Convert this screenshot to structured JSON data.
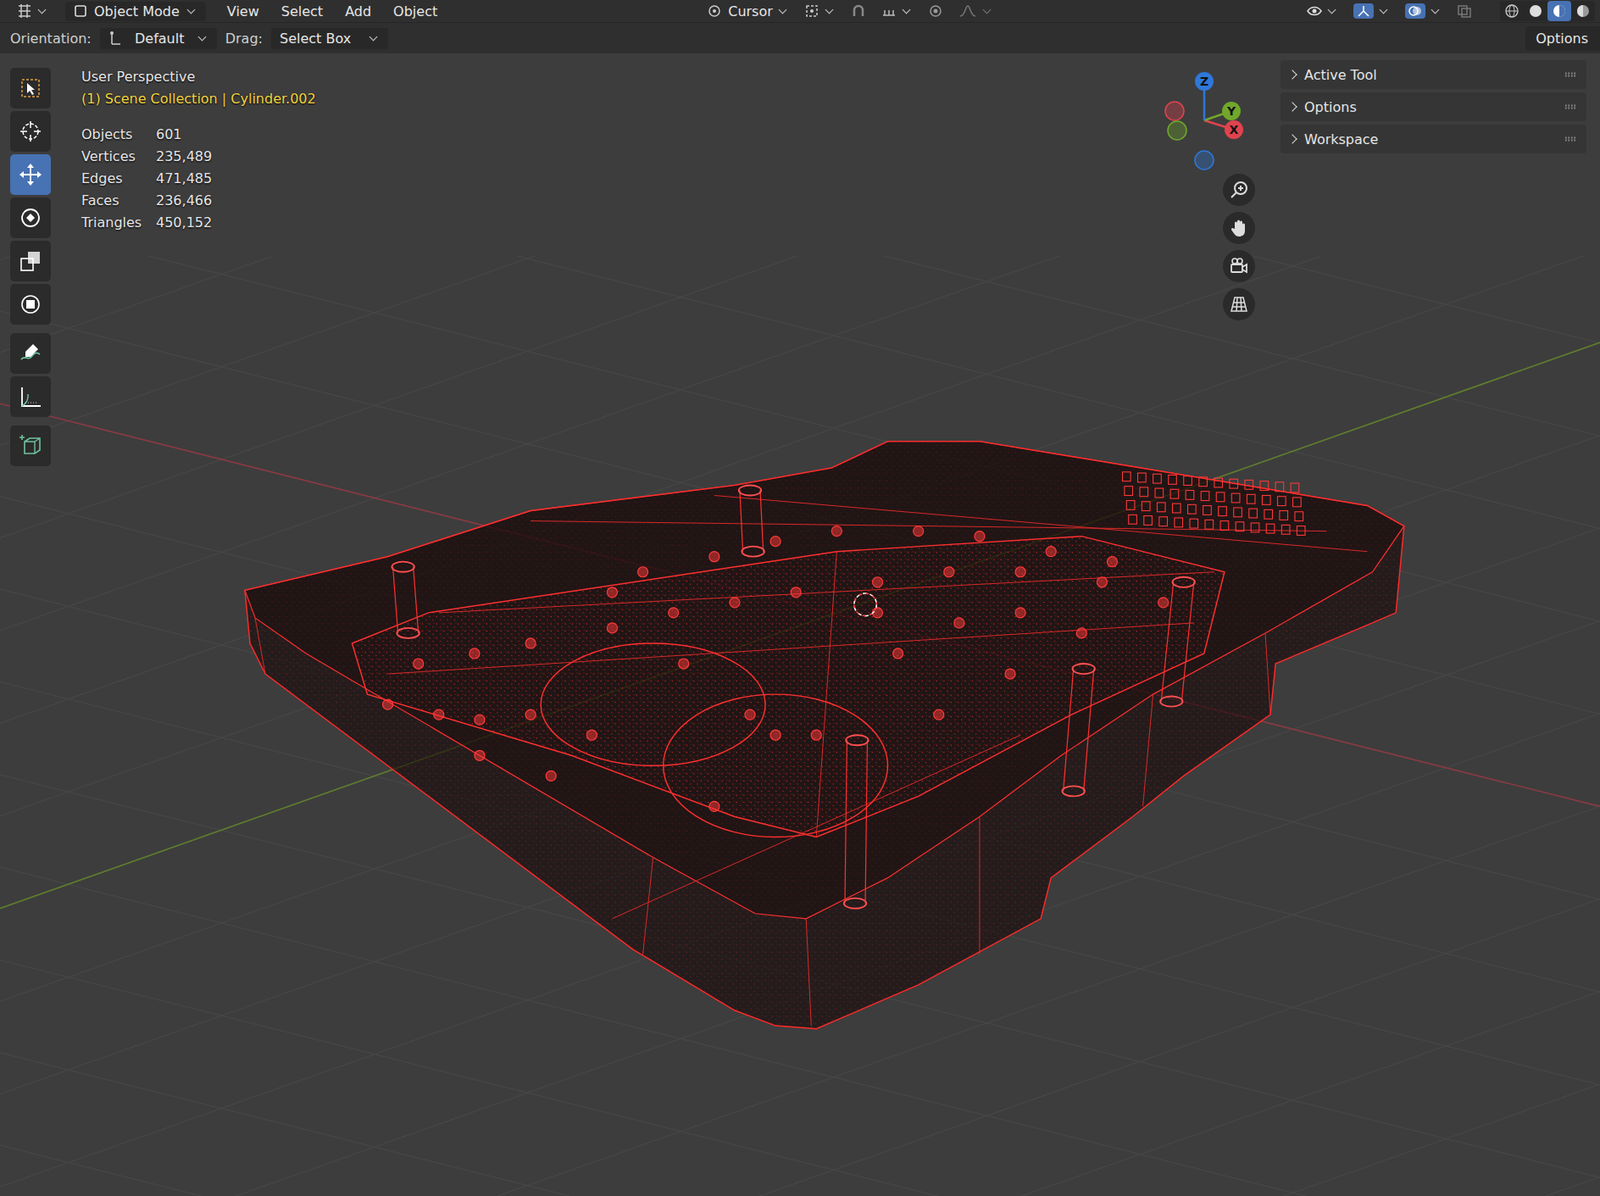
{
  "header": {
    "mode": "Object Mode",
    "menus": [
      "View",
      "Select",
      "Add",
      "Object"
    ],
    "pivot": "Cursor",
    "overlay_toggles": [
      {
        "on": false
      },
      {
        "on": true
      },
      {
        "on": true
      },
      {
        "on": false
      }
    ],
    "shading": [
      {
        "selected": false
      },
      {
        "selected": false
      },
      {
        "selected": true
      },
      {
        "selected": false
      }
    ]
  },
  "tool_settings": {
    "orientation_label": "Orientation:",
    "orientation": "Default",
    "drag_label": "Drag:",
    "drag": "Select Box",
    "options": "Options"
  },
  "viewport": {
    "view": "User Perspective",
    "collection": "(1) Scene Collection | Cylinder.002",
    "stats": [
      {
        "label": "Objects",
        "value": "601"
      },
      {
        "label": "Vertices",
        "value": "235,489"
      },
      {
        "label": "Edges",
        "value": "471,485"
      },
      {
        "label": "Faces",
        "value": "236,466"
      },
      {
        "label": "Triangles",
        "value": "450,152"
      }
    ]
  },
  "tools": [
    {
      "selected": false
    },
    {
      "selected": false
    },
    {
      "selected": true
    },
    {
      "selected": false
    },
    {
      "selected": false
    },
    {
      "selected": false
    },
    {
      "selected": false
    },
    {
      "selected": false
    },
    {
      "selected": false
    }
  ],
  "gizmo": {
    "axes": [
      {
        "label": "X",
        "color": "#e0434f"
      },
      {
        "label": "Y",
        "color": "#71a72b"
      },
      {
        "label": "Z",
        "color": "#2f77d9"
      }
    ]
  },
  "sidebar": {
    "panels": [
      {
        "label": "Active Tool",
        "expanded": false
      },
      {
        "label": "Options",
        "expanded": false
      },
      {
        "label": "Workspace",
        "expanded": false
      }
    ]
  }
}
